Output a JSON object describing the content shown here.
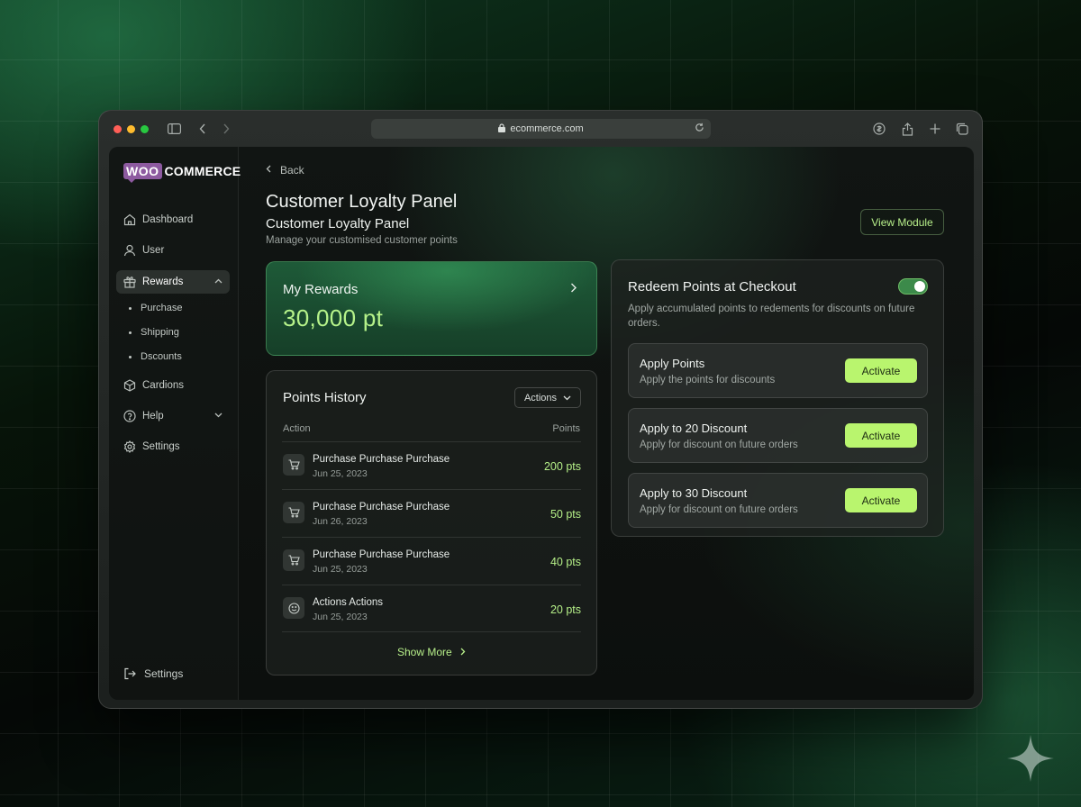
{
  "browser": {
    "url": "ecommerce.com",
    "icons": [
      "sidebar-toggle-icon",
      "back-arrow-icon",
      "forward-arrow-icon",
      "lock-icon",
      "reload-icon",
      "privacy-icon",
      "share-icon",
      "new-tab-icon",
      "tabs-overview-icon"
    ]
  },
  "brand": {
    "logo_woo": "WOO",
    "logo_commerce": "COMMERCE",
    "logo_color": "#8d5aa0"
  },
  "sidebar": {
    "items": [
      {
        "label": "Dashboard",
        "icon": "home-icon"
      },
      {
        "label": "User",
        "icon": "user-icon"
      },
      {
        "label": "Rewards",
        "icon": "gift-icon",
        "active": true,
        "expanded": true
      },
      {
        "label": "Cardions",
        "icon": "box-icon"
      },
      {
        "label": "Help",
        "icon": "help-circle-icon"
      },
      {
        "label": "Settings",
        "icon": "gear-icon"
      }
    ],
    "subitems": [
      {
        "label": "Purchase"
      },
      {
        "label": "Shipping"
      },
      {
        "label": "Dscounts"
      }
    ],
    "footer": {
      "label": "Settings",
      "icon": "logout-icon"
    }
  },
  "header": {
    "back_label": "Back",
    "title": "Customer Loyalty Panel",
    "subtitle": "Customer Loyalty Panel",
    "description": "Manage your customised customer points",
    "view_module_label": "View Module"
  },
  "rewards": {
    "label": "My Rewards",
    "value": "30,000 pt"
  },
  "history": {
    "title": "Points History",
    "actions_label": "Actions",
    "columns": [
      "Action",
      "Points"
    ],
    "rows": [
      {
        "name": "Purchase Purchase Purchase",
        "date": "Jun 25, 2023",
        "points": "200 pts",
        "icon": "cart-icon"
      },
      {
        "name": "Purchase Purchase Purchase",
        "date": "Jun 26, 2023",
        "points": "50 pts",
        "icon": "cart-icon"
      },
      {
        "name": "Purchase Purchase Purchase",
        "date": "Jun 25, 2023",
        "points": "40 pts",
        "icon": "cart-icon"
      },
      {
        "name": "Actions Actions",
        "date": "Jun 25, 2023",
        "points": "20 pts",
        "icon": "smiley-icon"
      }
    ],
    "show_more_label": "Show More"
  },
  "redeem": {
    "title": "Redeem Points at Checkout",
    "description": "Apply accumulated points to redements for discounts on future orders.",
    "toggle_on": true,
    "options": [
      {
        "name": "Apply Points",
        "description": "Apply the points for discounts",
        "button": "Activate"
      },
      {
        "name": "Apply to 20 Discount",
        "description": "Apply for discount on future orders",
        "button": "Activate"
      },
      {
        "name": "Apply to 30 Discount",
        "description": "Apply for discount on future orders",
        "button": "Activate"
      }
    ]
  },
  "colors": {
    "accent": "#b9f56e",
    "accent_text": "#b5ef88",
    "card_green": "#1e5a38"
  }
}
